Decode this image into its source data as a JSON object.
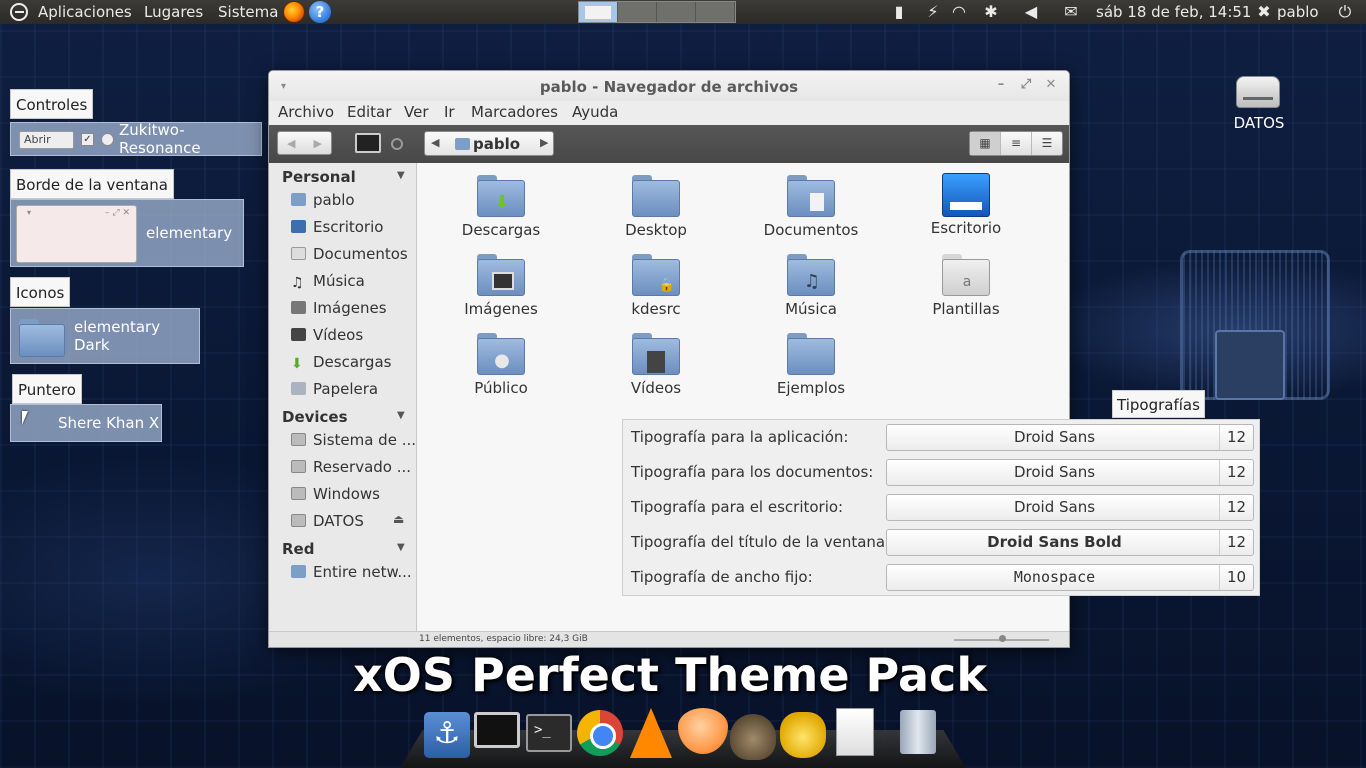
{
  "top_panel": {
    "menus": [
      "Aplicaciones",
      "Lugares",
      "Sistema"
    ],
    "datetime": "sáb 18 de feb, 14:51",
    "user": "pablo"
  },
  "themes": {
    "controls": {
      "label": "Controles",
      "mini_button": "Abrir",
      "name": "Zukitwo-Resonance"
    },
    "window_border": {
      "label": "Borde de la ventana",
      "name": "elementary"
    },
    "icons": {
      "label": "Iconos",
      "name": "elementary Dark"
    },
    "pointer": {
      "label": "Puntero",
      "name": "Shere Khan X"
    }
  },
  "file_manager": {
    "title": "pablo - Navegador de archivos",
    "menu": [
      "Archivo",
      "Editar",
      "Ver",
      "Ir",
      "Marcadores",
      "Ayuda"
    ],
    "path": "pablo",
    "sidebar": {
      "personal_header": "Personal",
      "personal": [
        "pablo",
        "Escritorio",
        "Documentos",
        "Música",
        "Imágenes",
        "Vídeos",
        "Descargas",
        "Papelera"
      ],
      "devices_header": "Devices",
      "devices": [
        "Sistema de ...",
        "Reservado ...",
        "Windows",
        "DATOS"
      ],
      "network_header": "Red",
      "network": [
        "Entire netw..."
      ]
    },
    "items": [
      "Descargas",
      "Desktop",
      "Documentos",
      "Escritorio",
      "Imágenes",
      "kdesrc",
      "Música",
      "Plantillas",
      "Público",
      "Vídeos",
      "Ejemplos"
    ],
    "status": "11 elementos, espacio libre: 24,3 GiB",
    "zoom_level": 0.5
  },
  "fonts": {
    "label": "Tipografías",
    "rows": [
      {
        "label": "Tipografía para la aplicación:",
        "font": "Droid Sans",
        "size": "12"
      },
      {
        "label": "Tipografía para los documentos:",
        "font": "Droid Sans",
        "size": "12"
      },
      {
        "label": "Tipografía para el escritorio:",
        "font": "Droid Sans",
        "size": "12"
      },
      {
        "label": "Tipografía del título de la ventana:",
        "font": "Droid Sans Bold",
        "size": "12"
      },
      {
        "label": "Tipografía de ancho fijo:",
        "font": "Monospace",
        "size": "10"
      }
    ]
  },
  "desktop": {
    "drive_label": "DATOS",
    "banner": "xOS Perfect Theme Pack"
  },
  "dock_icons": [
    "anchor-icon",
    "monitor-icon",
    "terminal-icon",
    "chrome-icon",
    "vlc-icon",
    "orange-icon",
    "gimp-icon",
    "teapot-icon",
    "document-icon",
    "trash-icon"
  ]
}
